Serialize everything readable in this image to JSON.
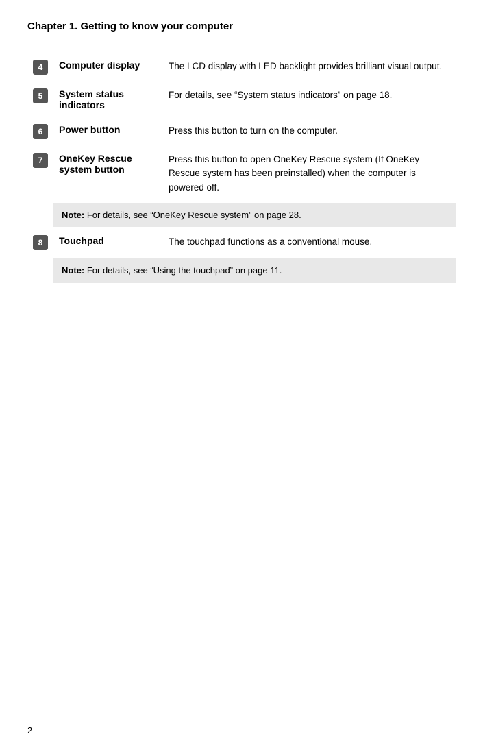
{
  "page": {
    "title": "Chapter 1. Getting to know your computer",
    "page_number": "2"
  },
  "items": [
    {
      "badge": "4",
      "term": "Computer display",
      "description": "The LCD display with LED backlight provides brilliant visual output.",
      "note": null
    },
    {
      "badge": "5",
      "term": "System status indicators",
      "description": "For details, see “System status indicators” on page 18.",
      "note": null
    },
    {
      "badge": "6",
      "term": "Power button",
      "description": "Press this button to turn on the computer.",
      "note": null
    },
    {
      "badge": "7",
      "term": "OneKey Rescue system button",
      "description": "Press this button to open OneKey Rescue system (If OneKey Rescue system has been preinstalled) when the computer is powered off.",
      "note": "Note: For details, see “OneKey Rescue system” on page 28."
    },
    {
      "badge": "8",
      "term": "Touchpad",
      "description": "The touchpad functions as a conventional mouse.",
      "note": "Note: For details, see “Using the touchpad” on page 11."
    }
  ]
}
